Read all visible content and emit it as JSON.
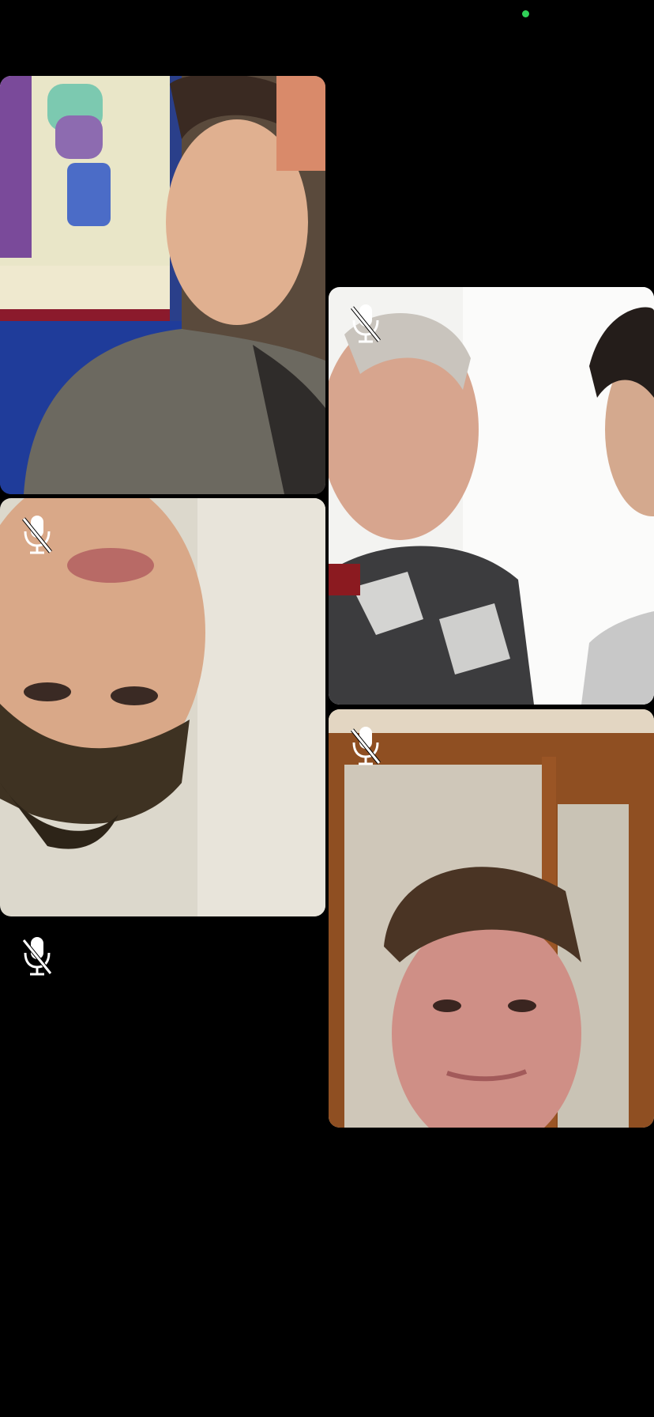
{
  "call": {
    "camera_indicator_color": "#30d158",
    "participants": [
      {
        "id": "participant-1",
        "muted": false,
        "video_description_icon": "video-feed"
      },
      {
        "id": "participant-2",
        "muted": true,
        "video_description_icon": "video-feed"
      },
      {
        "id": "participant-3",
        "muted": true,
        "video_description_icon": "video-feed"
      },
      {
        "id": "participant-4",
        "muted": true,
        "video_description_icon": "video-feed"
      },
      {
        "id": "participant-5",
        "muted": true,
        "video_description_icon": "mic-off-icon"
      }
    ]
  },
  "icons": {
    "mute": "mic-off-icon"
  }
}
